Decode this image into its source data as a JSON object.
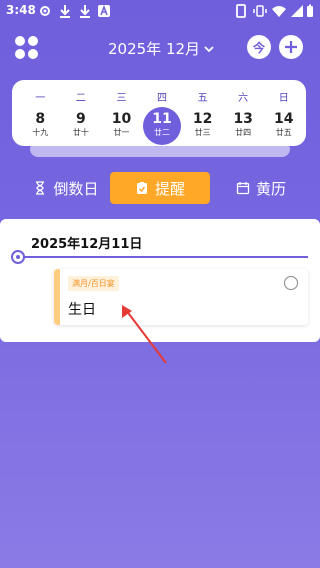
{
  "status_bar": {
    "time": "3:48"
  },
  "header": {
    "month": "2025年 12月",
    "today_label": "今",
    "add_label": "+"
  },
  "calendar": {
    "weekdays": [
      "一",
      "二",
      "三",
      "四",
      "五",
      "六",
      "日"
    ],
    "days": [
      {
        "num": "8",
        "lunar": "十九"
      },
      {
        "num": "9",
        "lunar": "廿十"
      },
      {
        "num": "10",
        "lunar": "廿一"
      },
      {
        "num": "11",
        "lunar": "廿二",
        "selected": true
      },
      {
        "num": "12",
        "lunar": "廿三"
      },
      {
        "num": "13",
        "lunar": "廿四"
      },
      {
        "num": "14",
        "lunar": "廿五"
      }
    ]
  },
  "tabs": {
    "countdown": "倒数日",
    "remind": "提醒",
    "almanac": "黄历"
  },
  "content": {
    "date_heading": "2025年12月11日",
    "event": {
      "tag": "满月/百日宴",
      "title": "生日"
    }
  },
  "colors": {
    "accent": "#6f5fdc",
    "remind_tab": "#ffa726",
    "event_bar": "#ffcc80",
    "annotation": "#e53935"
  }
}
